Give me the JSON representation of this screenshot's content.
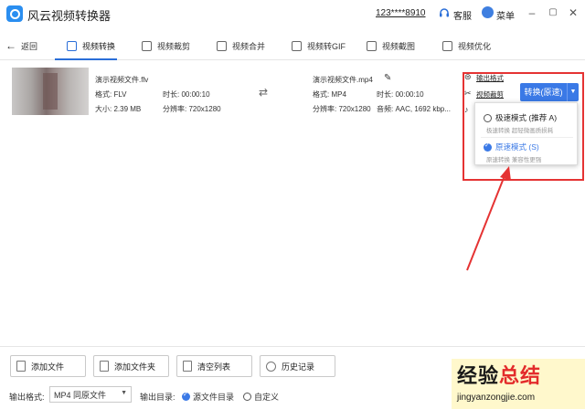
{
  "app": {
    "title": "风云视频转换器",
    "account": "123****8910",
    "service_label": "客服",
    "menu_label": "菜单"
  },
  "toolbar": {
    "back_label": "返回",
    "tabs": [
      {
        "label": "视频转换",
        "active": true
      },
      {
        "label": "视频裁剪"
      },
      {
        "label": "视频合并"
      },
      {
        "label": "视频转GIF"
      },
      {
        "label": "视频截图"
      },
      {
        "label": "视频优化"
      }
    ]
  },
  "file": {
    "source": {
      "name": "演示视频文件.flv",
      "format": "格式: FLV",
      "duration": "时长: 00:00:10",
      "size": "大小: 2.39 MB",
      "resolution": "分辨率: 720x1280"
    },
    "target": {
      "name": "演示视频文件.mp4",
      "format": "格式: MP4",
      "duration": "时长: 00:00:10",
      "resolution": "分辨率: 720x1280",
      "audio": "音频: AAC, 1692 kbp..."
    },
    "side_links": {
      "output_format": "输出格式",
      "video_crop": "视频裁剪"
    },
    "convert_button": "转换(原速)",
    "mode_options": [
      {
        "label": "极速模式 (推荐 A)",
        "desc": "极速转换 超轻微画质损耗",
        "selected": false
      },
      {
        "label": "原速模式 (S)",
        "desc": "原速转换 兼容性更强",
        "selected": true
      }
    ]
  },
  "bottom": {
    "buttons": [
      "添加文件",
      "添加文件夹",
      "清空列表",
      "历史记录"
    ],
    "output_format_label": "输出格式:",
    "output_format_value": "MP4 同原文件",
    "output_dir_label": "输出目录:",
    "dir_options": [
      {
        "label": "源文件目录",
        "selected": true
      },
      {
        "label": "自定义",
        "selected": false
      }
    ]
  },
  "watermark": {
    "title_black": "经验",
    "title_red": "总结",
    "url": "jingyanzongjie.com"
  },
  "colors": {
    "accent": "#3a79e6",
    "highlight": "#e53333"
  }
}
